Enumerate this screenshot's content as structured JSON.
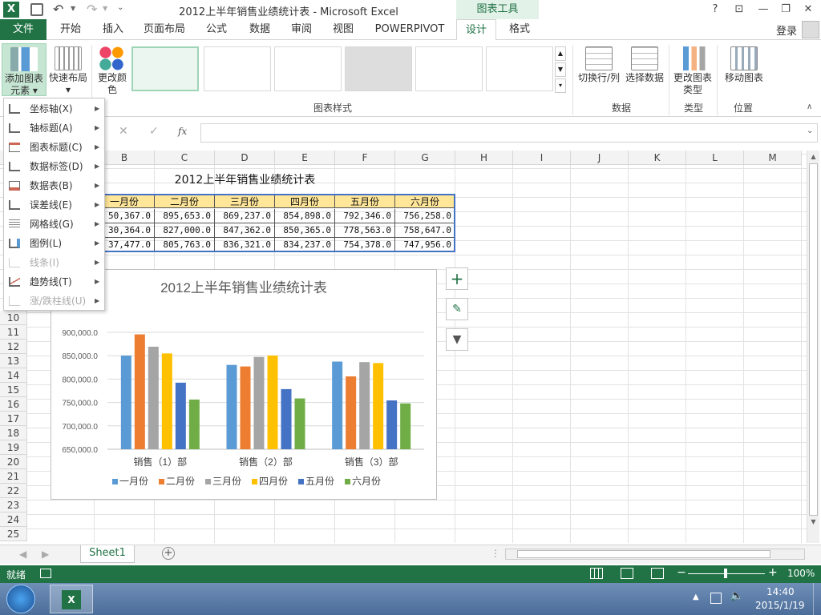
{
  "window": {
    "title": "2012上半年销售业绩统计表 - Microsoft Excel",
    "context_tab": "图表工具",
    "help": "?",
    "login": "登录"
  },
  "tabs": [
    "开始",
    "插入",
    "页面布局",
    "公式",
    "数据",
    "审阅",
    "视图",
    "POWERPIVOT",
    "设计",
    "格式"
  ],
  "file_tab": "文件",
  "active_tab": "设计",
  "ribbon": {
    "add_element": "添加图表元素",
    "quick_layout": "快速布局",
    "change_colors": "更改颜色",
    "chart_styles_group": "图表样式",
    "switch_row_col": "切换行/列",
    "select_data": "选择数据",
    "data_group": "数据",
    "change_type": "更改图表类型",
    "type_group": "类型",
    "move_chart": "移动图表",
    "location_group": "位置"
  },
  "formula_bar": {
    "fx": "fx"
  },
  "dropdown": [
    {
      "label": "坐标轴(X)",
      "enabled": true
    },
    {
      "label": "轴标题(A)",
      "enabled": true
    },
    {
      "label": "图表标题(C)",
      "enabled": true
    },
    {
      "label": "数据标签(D)",
      "enabled": true
    },
    {
      "label": "数据表(B)",
      "enabled": true
    },
    {
      "label": "误差线(E)",
      "enabled": true
    },
    {
      "label": "网格线(G)",
      "enabled": true
    },
    {
      "label": "图例(L)",
      "enabled": true
    },
    {
      "label": "线条(I)",
      "enabled": false
    },
    {
      "label": "趋势线(T)",
      "enabled": true
    },
    {
      "label": "涨/跌柱线(U)",
      "enabled": false
    }
  ],
  "columns": [
    "B",
    "C",
    "D",
    "E",
    "F",
    "G",
    "H",
    "I",
    "J",
    "K",
    "L",
    "M"
  ],
  "rows": [
    "10",
    "11",
    "12",
    "13",
    "14",
    "15",
    "16",
    "17",
    "18",
    "19",
    "20",
    "21",
    "22",
    "23",
    "24",
    "25"
  ],
  "sheet": {
    "title": "2012上半年销售业绩统计表",
    "headers": [
      "一月份",
      "二月份",
      "三月份",
      "四月份",
      "五月份",
      "六月份"
    ],
    "data": [
      [
        "50,367.0",
        "895,653.0",
        "869,237.0",
        "854,898.0",
        "792,346.0",
        "756,258.0"
      ],
      [
        "30,364.0",
        "827,000.0",
        "847,362.0",
        "850,365.0",
        "778,563.0",
        "758,647.0"
      ],
      [
        "37,477.0",
        "805,763.0",
        "836,321.0",
        "834,237.0",
        "754,378.0",
        "747,956.0"
      ]
    ]
  },
  "chart_data": {
    "type": "bar",
    "title": "2012上半年销售业绩统计表",
    "categories": [
      "销售（1）部",
      "销售（2）部",
      "销售（3）部"
    ],
    "ylim": [
      650000,
      900000
    ],
    "yticks": [
      "650,000.0",
      "700,000.0",
      "750,000.0",
      "800,000.0",
      "850,000.0",
      "900,000.0"
    ],
    "series": [
      {
        "name": "一月份",
        "color": "#5b9bd5",
        "values": [
          850367,
          830364,
          837477
        ]
      },
      {
        "name": "二月份",
        "color": "#ed7d31",
        "values": [
          895653,
          827000,
          805763
        ]
      },
      {
        "name": "三月份",
        "color": "#a5a5a5",
        "values": [
          869237,
          847362,
          836321
        ]
      },
      {
        "name": "四月份",
        "color": "#ffc000",
        "values": [
          854898,
          850365,
          834237
        ]
      },
      {
        "name": "五月份",
        "color": "#4472c4",
        "values": [
          792346,
          778563,
          754378
        ]
      },
      {
        "name": "六月份",
        "color": "#70ad47",
        "values": [
          756258,
          758647,
          747956
        ]
      }
    ],
    "legend": "bottom",
    "grid": true
  },
  "sheet_tab": "Sheet1",
  "status": {
    "ready": "就绪",
    "zoom": "100%"
  },
  "taskbar": {
    "time": "14:40",
    "date": "2015/1/19"
  }
}
